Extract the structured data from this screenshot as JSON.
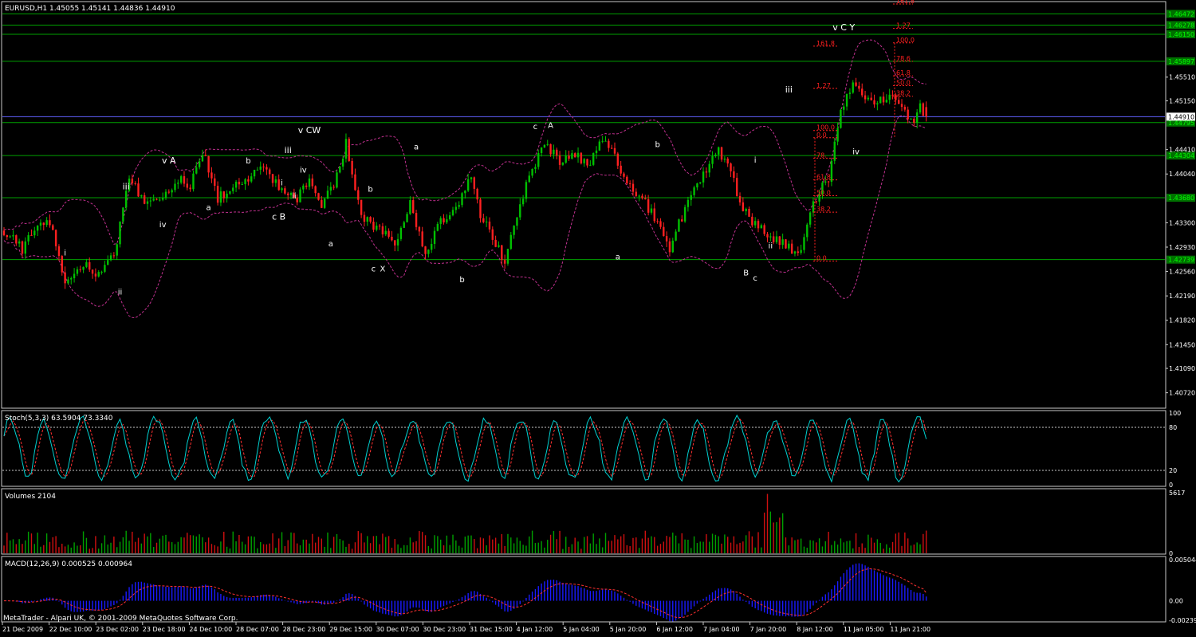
{
  "window": {
    "header": "EURUSD,H1  1.45055 1.45141 1.44836 1.44910",
    "footer": "MetaTrader - Alpari UK, © 2001-2009 MetaQuotes Software Corp."
  },
  "chart_data": [
    {
      "type": "candlestick",
      "symbol": "EURUSD",
      "timeframe": "H1",
      "ohlc_header": {
        "open": 1.45055,
        "high": 1.45141,
        "low": 1.44836,
        "close": 1.4491
      },
      "ylim": [
        1.4051,
        1.4662
      ],
      "price_ticks": [
        "1.45510",
        "1.45150",
        "1.44410",
        "1.44040",
        "1.43300",
        "1.42930",
        "1.42560",
        "1.42190",
        "1.41820",
        "1.41450",
        "1.41090",
        "1.40720"
      ],
      "current_price": "1.44910",
      "x_tick_labels": [
        "21 Dec 2009",
        "22 Dec 10:00",
        "23 Dec 02:00",
        "23 Dec 18:00",
        "24 Dec 10:00",
        "28 Dec 07:00",
        "28 Dec 23:00",
        "29 Dec 15:00",
        "30 Dec 07:00",
        "30 Dec 23:00",
        "31 Dec 15:00",
        "4 Jan 12:00",
        "5 Jan 04:00",
        "5 Jan 20:00",
        "6 Jan 12:00",
        "7 Jan 04:00",
        "7 Jan 20:00",
        "8 Jan 12:00",
        "11 Jan 05:00",
        "11 Jan 21:00"
      ],
      "price_path": [
        [
          0,
          1.4318
        ],
        [
          6,
          1.429
        ],
        [
          12,
          1.4335
        ],
        [
          16,
          1.4318
        ],
        [
          20,
          1.424
        ],
        [
          26,
          1.4265
        ],
        [
          30,
          1.4255
        ],
        [
          36,
          1.428
        ],
        [
          41,
          1.44
        ],
        [
          47,
          1.4355
        ],
        [
          52,
          1.437
        ],
        [
          57,
          1.4398
        ],
        [
          61,
          1.4385
        ],
        [
          65,
          1.4438
        ],
        [
          70,
          1.4365
        ],
        [
          75,
          1.439
        ],
        [
          80,
          1.44
        ],
        [
          85,
          1.441
        ],
        [
          90,
          1.4385
        ],
        [
          96,
          1.4368
        ],
        [
          100,
          1.4395
        ],
        [
          104,
          1.436
        ],
        [
          108,
          1.4385
        ],
        [
          112,
          1.445
        ],
        [
          117,
          1.434
        ],
        [
          123,
          1.432
        ],
        [
          128,
          1.43
        ],
        [
          133,
          1.436
        ],
        [
          138,
          1.4285
        ],
        [
          143,
          1.433
        ],
        [
          148,
          1.4355
        ],
        [
          153,
          1.44
        ],
        [
          156,
          1.434
        ],
        [
          160,
          1.431
        ],
        [
          164,
          1.427
        ],
        [
          168,
          1.4345
        ],
        [
          172,
          1.44
        ],
        [
          177,
          1.4455
        ],
        [
          182,
          1.442
        ],
        [
          187,
          1.4435
        ],
        [
          191,
          1.4415
        ],
        [
          196,
          1.4462
        ],
        [
          201,
          1.442
        ],
        [
          205,
          1.4385
        ],
        [
          210,
          1.436
        ],
        [
          214,
          1.433
        ],
        [
          218,
          1.429
        ],
        [
          222,
          1.434
        ],
        [
          226,
          1.438
        ],
        [
          230,
          1.441
        ],
        [
          234,
          1.444
        ],
        [
          238,
          1.4405
        ],
        [
          242,
          1.435
        ],
        [
          246,
          1.4325
        ],
        [
          251,
          1.431
        ],
        [
          255,
          1.43
        ],
        [
          258,
          1.429
        ],
        [
          260,
          1.4278
        ],
        [
          263,
          1.433
        ],
        [
          266,
          1.437
        ],
        [
          270,
          1.44
        ],
        [
          274,
          1.45
        ],
        [
          278,
          1.454
        ],
        [
          282,
          1.452
        ],
        [
          286,
          1.451
        ],
        [
          290,
          1.4525
        ],
        [
          294,
          1.4505
        ],
        [
          297,
          1.448
        ],
        [
          300,
          1.4505
        ],
        [
          302,
          1.4491
        ]
      ],
      "bars_shown": 303,
      "fibonacci_levels": [
        {
          "label": "161.8",
          "price": 1.4662
        },
        {
          "label": "1.27",
          "price": 1.4625
        },
        {
          "label": "100.0",
          "price": 1.4603
        },
        {
          "label": "161.8",
          "price": 1.4598
        },
        {
          "label": "78.6",
          "price": 1.4575
        },
        {
          "label": "61.8",
          "price": 1.4553
        },
        {
          "label": "50.0",
          "price": 1.4538
        },
        {
          "label": "1.27",
          "price": 1.4534
        },
        {
          "label": "38.2",
          "price": 1.4522
        },
        {
          "label": "100.0",
          "price": 1.447
        },
        {
          "label": "0.0",
          "price": 1.4459
        },
        {
          "label": "78.",
          "price": 1.4428
        },
        {
          "label": "61.8",
          "price": 1.4395
        },
        {
          "label": "50.0",
          "price": 1.4371
        },
        {
          "label": "38.2",
          "price": 1.4346
        },
        {
          "label": "0.0",
          "price": 1.4272
        }
      ],
      "support_resistance_levels": [
        {
          "price": 1.4647,
          "label": "1.46472"
        },
        {
          "price": 1.463,
          "label": "1.46278"
        },
        {
          "price": 1.4616,
          "label": "1.46150"
        },
        {
          "price": 1.4575,
          "label": "1.45897"
        },
        {
          "price": 1.4482,
          "label": "1.44795"
        },
        {
          "price": 1.4432,
          "label": "1.44304"
        },
        {
          "price": 1.4368,
          "label": "1.43680"
        },
        {
          "price": 1.4274,
          "label": "1.42739"
        }
      ],
      "wave_labels": [
        {
          "text": "v C Y",
          "bar": 275,
          "price": 1.4622
        },
        {
          "text": "v CW",
          "bar": 100,
          "price": 1.4466
        },
        {
          "text": "c",
          "bar": 174,
          "price": 1.4472
        },
        {
          "text": "A",
          "bar": 179,
          "price": 1.4474
        },
        {
          "text": "v A",
          "bar": 54,
          "price": 1.442
        },
        {
          "text": "iii",
          "bar": 40,
          "price": 1.4381
        },
        {
          "text": "iii",
          "bar": 93,
          "price": 1.4436
        },
        {
          "text": "iv",
          "bar": 52,
          "price": 1.4323
        },
        {
          "text": "a",
          "bar": 67,
          "price": 1.4349
        },
        {
          "text": "b",
          "bar": 80,
          "price": 1.442
        },
        {
          "text": "i",
          "bar": 91,
          "price": 1.4387
        },
        {
          "text": "iv",
          "bar": 98,
          "price": 1.4406
        },
        {
          "text": "ii",
          "bar": 95,
          "price": 1.4367
        },
        {
          "text": "c B",
          "bar": 90,
          "price": 1.4335
        },
        {
          "text": "b",
          "bar": 120,
          "price": 1.4377
        },
        {
          "text": "a",
          "bar": 107,
          "price": 1.4294
        },
        {
          "text": "c",
          "bar": 121,
          "price": 1.4256
        },
        {
          "text": "X",
          "bar": 124,
          "price": 1.4256
        },
        {
          "text": "a",
          "bar": 135,
          "price": 1.4441
        },
        {
          "text": "b",
          "bar": 150,
          "price": 1.424
        },
        {
          "text": "b",
          "bar": 214,
          "price": 1.4445
        },
        {
          "text": "a",
          "bar": 201,
          "price": 1.4274
        },
        {
          "text": "i",
          "bar": 20,
          "price": 1.428
        },
        {
          "text": "ii",
          "bar": 38,
          "price": 1.4221
        },
        {
          "text": "i",
          "bar": 246,
          "price": 1.4421
        },
        {
          "text": "ii",
          "bar": 251,
          "price": 1.4291
        },
        {
          "text": "B",
          "bar": 243,
          "price": 1.425
        },
        {
          "text": "c",
          "bar": 246,
          "price": 1.4242
        },
        {
          "text": "iii",
          "bar": 257,
          "price": 1.4528
        },
        {
          "text": "iv",
          "bar": 279,
          "price": 1.4434
        }
      ],
      "indicator_overlays": [
        "Bollinger Bands (dashed purple)",
        "horizontal trendlines (green)",
        "Fibonacci retracement (red dashed)"
      ]
    },
    {
      "type": "line",
      "name": "Stoch(5,3,3) 63.5904 73.3340",
      "ylim": [
        0,
        100
      ],
      "levels": [
        80,
        20
      ],
      "y_tick_labels": [
        "100",
        "80",
        "20",
        "0"
      ],
      "series": [
        {
          "name": "main",
          "color": "#00d0d0"
        },
        {
          "name": "signal",
          "color": "#ff3030"
        }
      ],
      "last_values": {
        "main": 63.5904,
        "signal": 73.334
      }
    },
    {
      "type": "bar",
      "name": "Volumes 2104",
      "ylim": [
        0,
        5617
      ],
      "y_tick_labels": [
        "5617",
        "0"
      ],
      "last_value": 2104,
      "up_color": "#00a000",
      "down_color": "#d01010"
    },
    {
      "type": "bar",
      "name": "MACD(12,26,9) 0.000525 0.000964",
      "ylim": [
        -0.00239,
        0.005044
      ],
      "y_tick_labels": [
        "0.005044",
        "0.00",
        "-0.00239"
      ],
      "histogram_color": "#1a1aff",
      "signal_color": "#ff3030",
      "last_values": {
        "macd": 0.000525,
        "signal": 0.000964
      }
    }
  ],
  "colors": {
    "background": "#000000",
    "up_candle": "#00c000",
    "down_candle": "#ff2020",
    "level_line": "#00a000",
    "fib": "#ff2020",
    "bands": "#c0308f",
    "price_line": "#6060ff"
  }
}
